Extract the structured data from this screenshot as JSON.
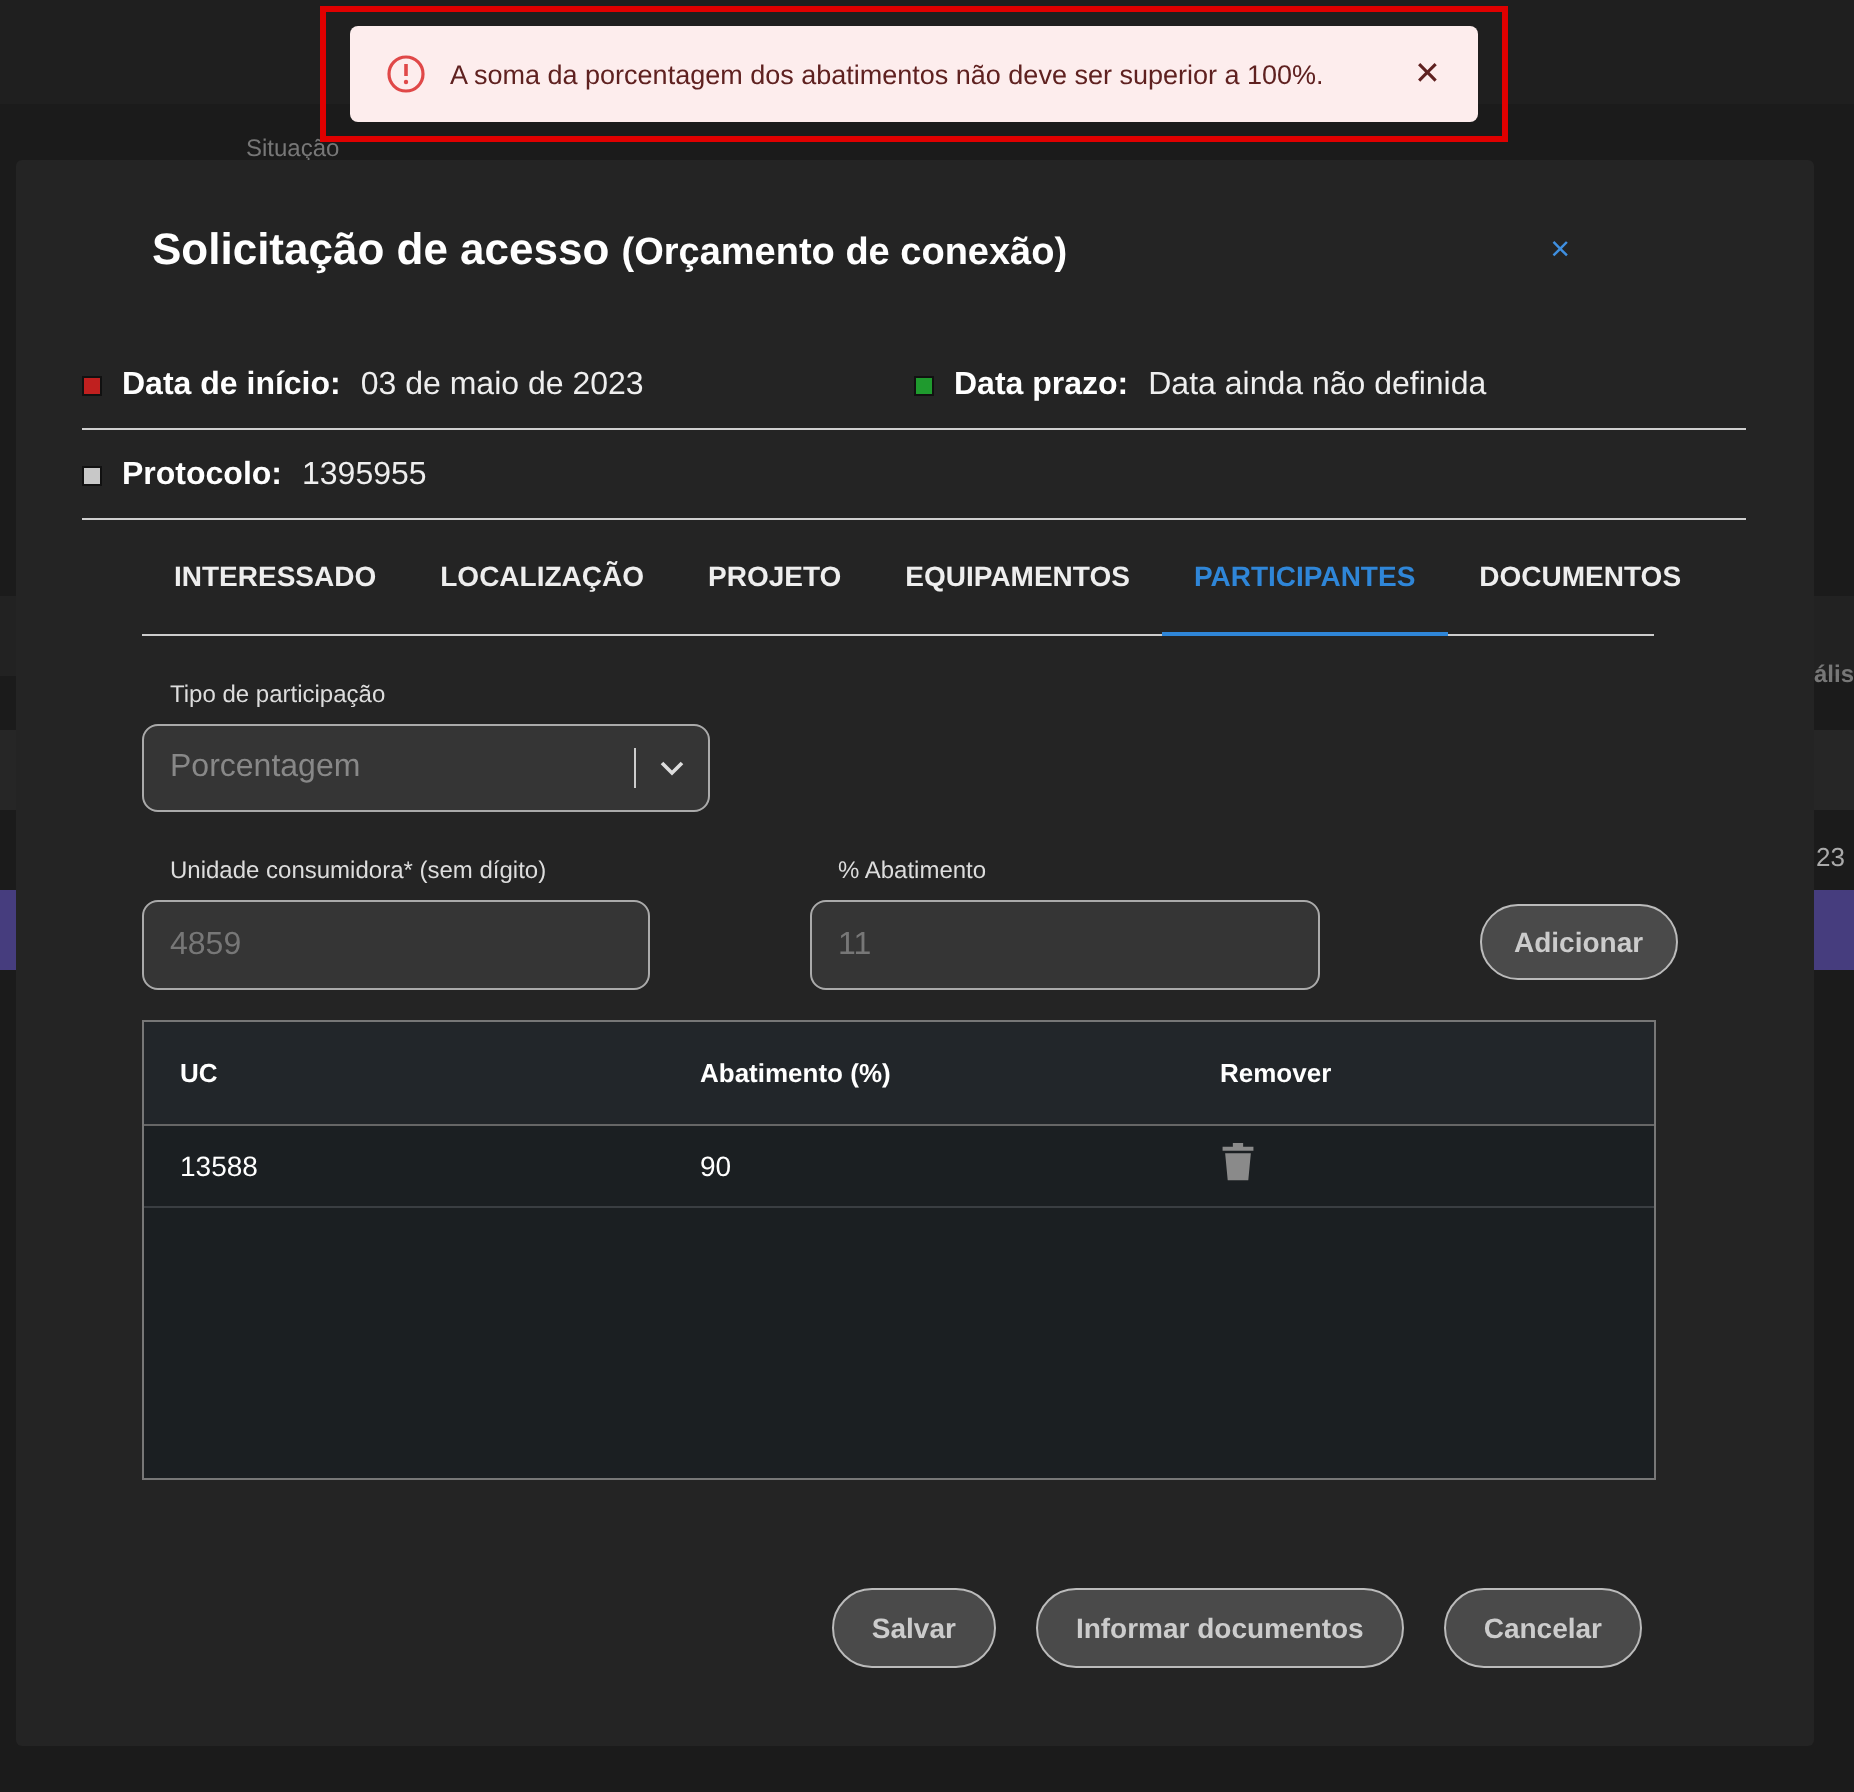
{
  "background": {
    "texts": [
      {
        "text": "Situação",
        "kind": "label"
      },
      {
        "text": "ális",
        "kind": "right1"
      },
      {
        "text": "23",
        "kind": "right2"
      }
    ]
  },
  "toast": {
    "message": "A soma da porcentagem dos abatimentos não deve ser superior a 100%.",
    "close": "✕",
    "highlighted": true
  },
  "dialog": {
    "title": "Solicitação de acesso",
    "subtitle": "(Orçamento de conexão)",
    "close": "×",
    "info": [
      {
        "label": "Data de início:",
        "value": "03 de maio de 2023",
        "color": "#c0201f"
      },
      {
        "label": "Data prazo:",
        "value": "Data ainda não definida",
        "color": "#1f9a2e"
      },
      {
        "label": "Protocolo:",
        "value": "1395955",
        "color": "#c8c8c8"
      }
    ],
    "tabs": [
      {
        "label": "INTERESSADO",
        "selected": false
      },
      {
        "label": "LOCALIZAÇÃO",
        "selected": false
      },
      {
        "label": "PROJETO",
        "selected": false
      },
      {
        "label": "EQUIPAMENTOS",
        "selected": false
      },
      {
        "label": "PARTICIPANTES",
        "selected": true
      },
      {
        "label": "DOCUMENTOS",
        "selected": false
      }
    ],
    "participation_type": {
      "label": "Tipo de participação",
      "placeholder": "Porcentagem"
    },
    "consumer_unit": {
      "label": "Unidade consumidora* (sem dígito)",
      "placeholder": "4859"
    },
    "discount": {
      "label": "% Abatimento",
      "placeholder": "11"
    },
    "add_button": "Adicionar",
    "table": {
      "columns": [
        "UC",
        "Abatimento (%)",
        "Remover"
      ],
      "rows": [
        {
          "uc": "13588",
          "discount": "90"
        }
      ]
    },
    "buttons": [
      "Salvar",
      "Informar documentos",
      "Cancelar"
    ]
  }
}
